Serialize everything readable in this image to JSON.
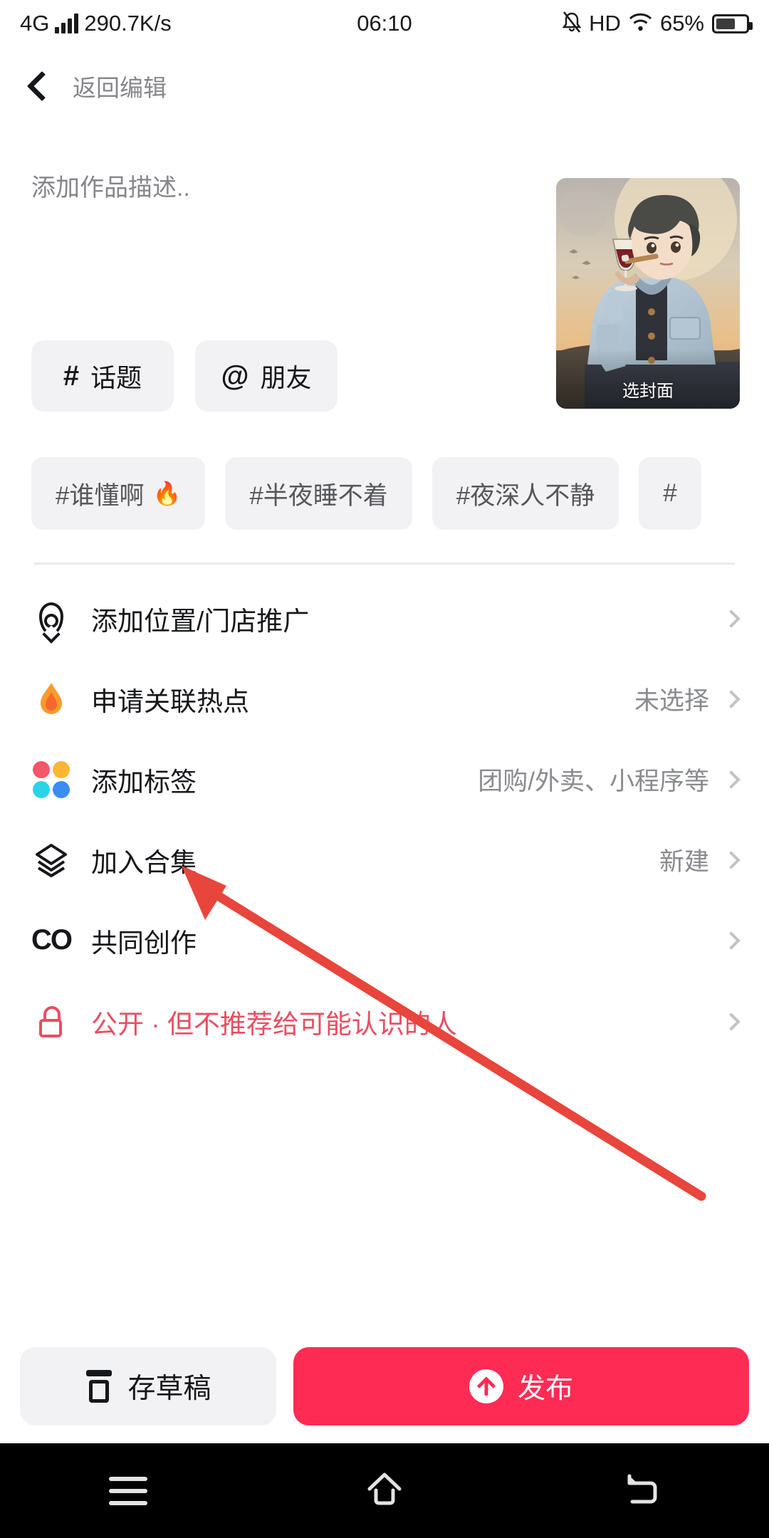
{
  "status_bar": {
    "network_type": "4G",
    "speed": "290.7K/s",
    "time": "06:10",
    "hd_label": "HD",
    "battery_percent": "65%",
    "battery_level": 65,
    "icons": [
      "signal-bars-icon",
      "mute-icon",
      "hd-icon",
      "wifi-icon",
      "battery-icon"
    ]
  },
  "nav": {
    "back_label": "返回编辑",
    "back_icon": "chevron-left-icon"
  },
  "compose": {
    "description_placeholder": "添加作品描述..",
    "description_value": "",
    "cover_label": "选封面"
  },
  "quick_chips": [
    {
      "glyph": "#",
      "label": "话题",
      "icon": "hash-icon"
    },
    {
      "glyph": "@",
      "label": "朋友",
      "icon": "at-icon"
    }
  ],
  "tag_suggestions": [
    {
      "text": "#谁懂啊",
      "emoji": "🔥"
    },
    {
      "text": "#半夜睡不着",
      "emoji": ""
    },
    {
      "text": "#夜深人不静",
      "emoji": ""
    },
    {
      "text": "#",
      "emoji": ""
    }
  ],
  "options": [
    {
      "icon": "location-pin-icon",
      "label": "添加位置/门店推广",
      "value": ""
    },
    {
      "icon": "flame-icon",
      "label": "申请关联热点",
      "value": "未选择"
    },
    {
      "icon": "four-dots-icon",
      "label": "添加标签",
      "value": "团购/外卖、小程序等"
    },
    {
      "icon": "layers-icon",
      "label": "加入合集",
      "value": "新建"
    },
    {
      "icon": "co-create-icon",
      "label": "共同创作",
      "value": ""
    },
    {
      "icon": "unlock-icon",
      "label": "公开 · 但不推荐给可能认识的人",
      "value": ""
    }
  ],
  "bottom_actions": {
    "save_draft_label": "存草稿",
    "save_draft_icon": "draft-box-icon",
    "publish_label": "发布",
    "publish_icon": "upload-arrow-icon"
  },
  "android_nav": {
    "recents_icon": "recents-icon",
    "home_icon": "home-icon",
    "back_icon": "back-icon"
  },
  "colors": {
    "accent_red": "#fe2c55",
    "privacy_pink": "#e84e62",
    "chip_bg": "#f2f2f4",
    "muted_text": "#8a8b8f",
    "annotation_arrow": "#e8453c"
  },
  "annotation": {
    "type": "arrow",
    "points_to": "添加标签"
  }
}
